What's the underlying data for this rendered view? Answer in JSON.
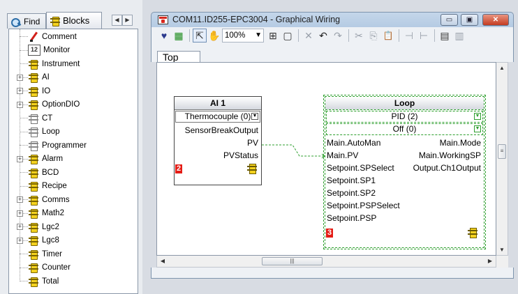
{
  "panel": {
    "tabs": {
      "find": "Find",
      "blocks": "Blocks"
    },
    "scroll_left": "◀",
    "scroll_right": "▶",
    "tree": [
      {
        "label": "Comment",
        "icon": "comment-icon",
        "expandable": false
      },
      {
        "label": "Monitor",
        "icon": "monitor-icon",
        "expandable": false,
        "icon_text": "12"
      },
      {
        "label": "Instrument",
        "icon": "block-icon",
        "expandable": false
      },
      {
        "label": "AI",
        "icon": "block-icon",
        "expandable": true
      },
      {
        "label": "IO",
        "icon": "block-icon",
        "expandable": true
      },
      {
        "label": "OptionDIO",
        "icon": "block-icon",
        "expandable": true
      },
      {
        "label": "CT",
        "icon": "block-outline-icon",
        "expandable": false
      },
      {
        "label": "Loop",
        "icon": "block-outline-icon",
        "expandable": false
      },
      {
        "label": "Programmer",
        "icon": "block-outline-icon",
        "expandable": false
      },
      {
        "label": "Alarm",
        "icon": "block-icon",
        "expandable": true
      },
      {
        "label": "BCD",
        "icon": "block-icon",
        "expandable": false
      },
      {
        "label": "Recipe",
        "icon": "block-icon",
        "expandable": false
      },
      {
        "label": "Comms",
        "icon": "block-icon",
        "expandable": true
      },
      {
        "label": "Math2",
        "icon": "block-icon",
        "expandable": true
      },
      {
        "label": "Lgc2",
        "icon": "block-icon",
        "expandable": true
      },
      {
        "label": "Lgc8",
        "icon": "block-icon",
        "expandable": true
      },
      {
        "label": "Timer",
        "icon": "block-icon",
        "expandable": false
      },
      {
        "label": "Counter",
        "icon": "block-icon",
        "expandable": false
      },
      {
        "label": "Total",
        "icon": "block-icon",
        "expandable": false
      }
    ]
  },
  "window": {
    "title": "COM11.ID255-EPC3004 - Graphical Wiring",
    "minimize": "▭",
    "maximize": "▣",
    "close": "✕",
    "zoom": "100%",
    "zoom_dropdown": "▼",
    "tab": "Top"
  },
  "toolbar_icons": {
    "heart": "♥",
    "grid": "▦",
    "pointer": "⇱",
    "hand": "✋",
    "fit": "⊞",
    "frame": "▢",
    "delete": "✕",
    "undo": "↶",
    "redo": "↷",
    "cut": "✂",
    "copy": "⎘",
    "paste": "📋",
    "wire1": "⊣",
    "wire2": "⊢",
    "layout1": "▤",
    "layout2": "▥"
  },
  "colors": {
    "selection_dashed": "#2c9e2c",
    "exec_badge": "#e41c15",
    "wire": "#2c9e2c"
  },
  "blocks": {
    "ai1": {
      "title": "AI 1",
      "param": "Thermocouple (0)",
      "outputs": [
        "SensorBreakOutput",
        "PV",
        "PVStatus"
      ],
      "exec_order": "2"
    },
    "loop": {
      "title": "Loop",
      "params": [
        "PID (2)",
        "Off (0)"
      ],
      "inputs": [
        "Main.AutoMan",
        "Main.PV",
        "Setpoint.SPSelect",
        "Setpoint.SP1",
        "Setpoint.SP2",
        "Setpoint.PSPSelect",
        "Setpoint.PSP"
      ],
      "outputs": [
        "Main.Mode",
        "Main.WorkingSP",
        "Output.Ch1Output"
      ],
      "exec_order": "3"
    }
  },
  "scroll": {
    "up": "▲",
    "down": "▼",
    "left": "◀",
    "right": "▶",
    "grip_v": "≡",
    "grip_h": "|||"
  }
}
